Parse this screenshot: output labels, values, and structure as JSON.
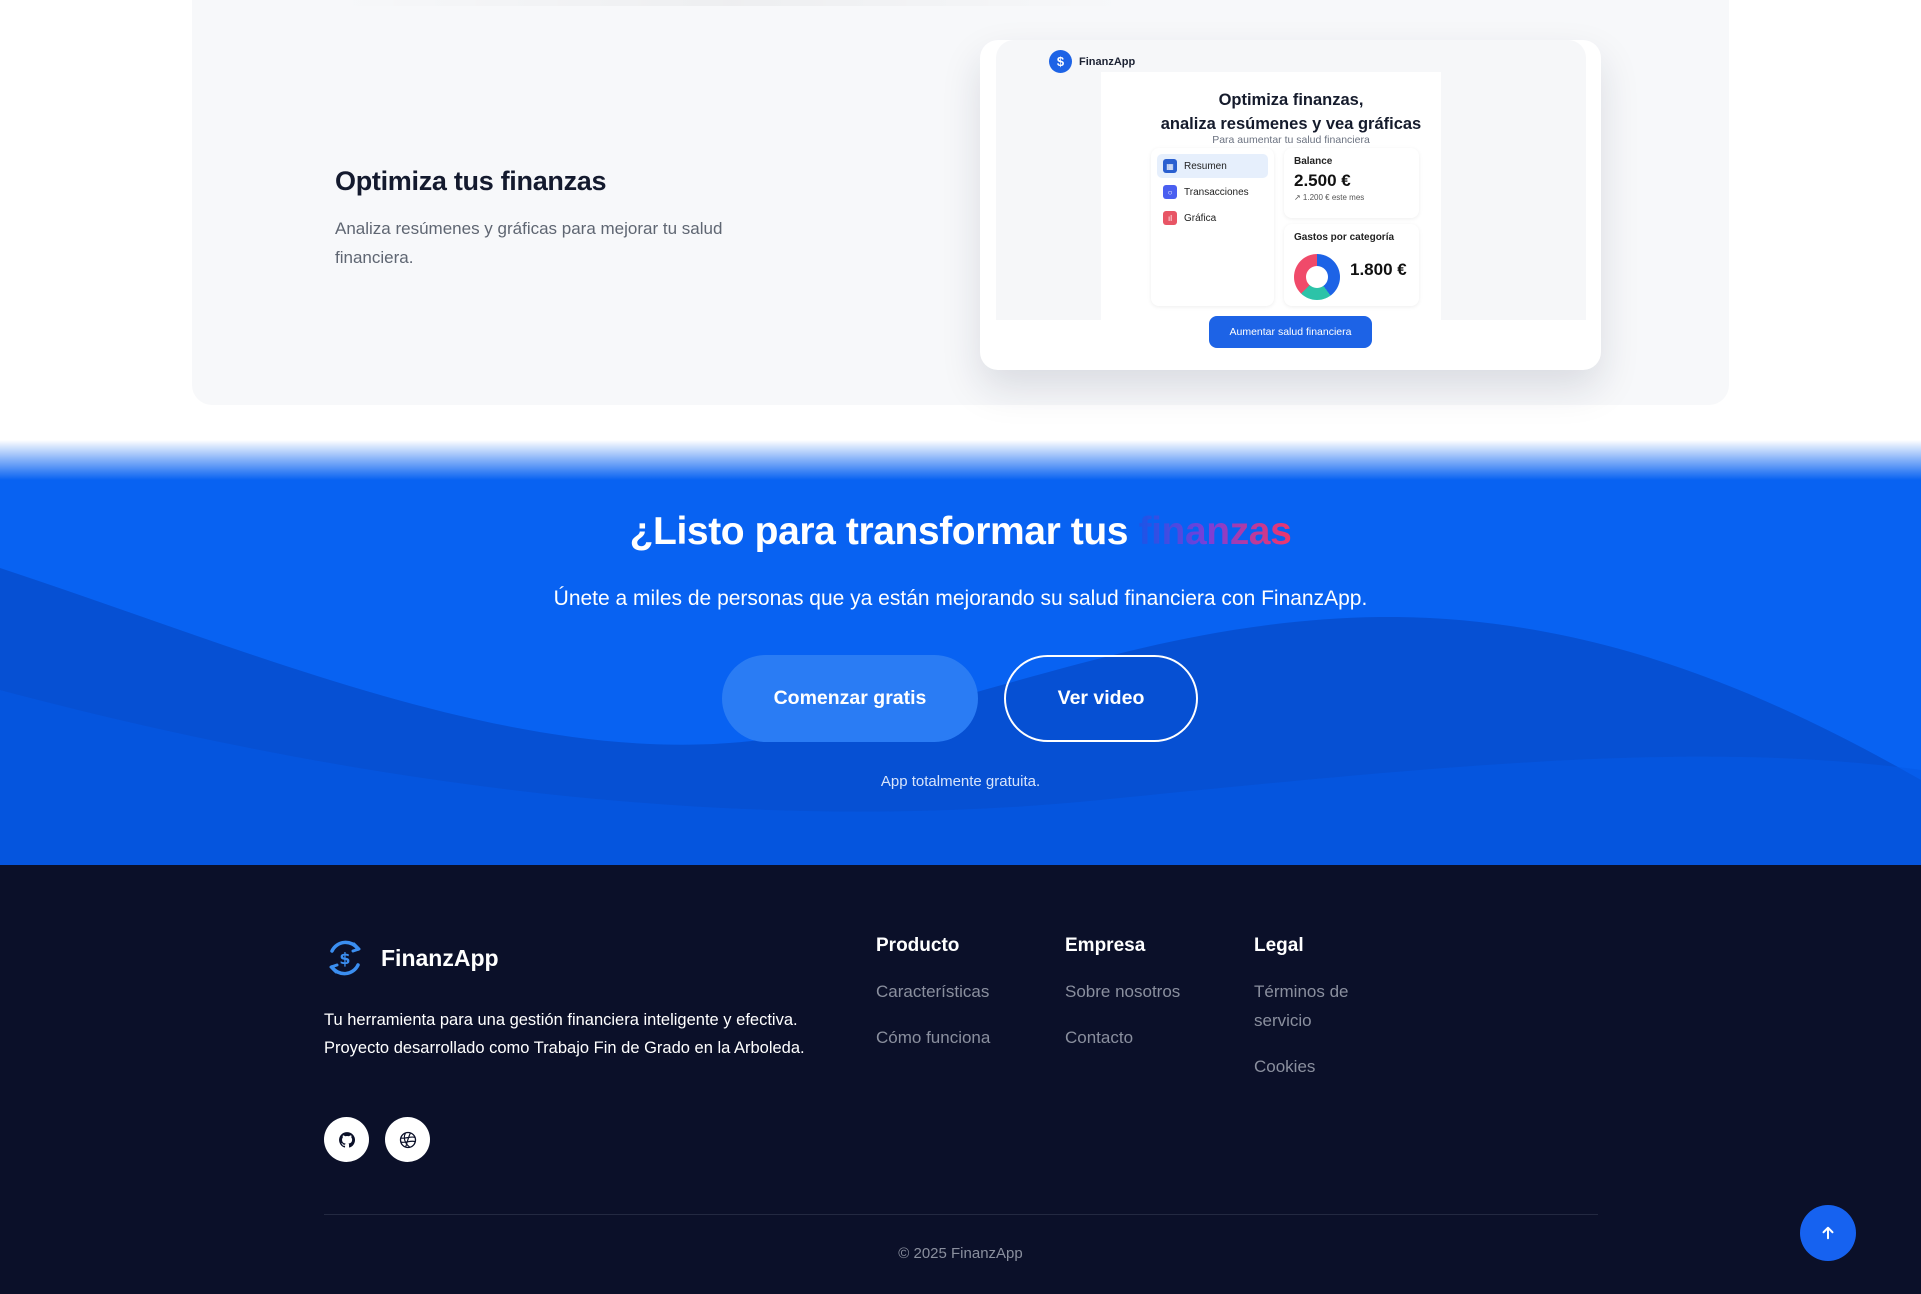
{
  "feature": {
    "title": "Optimiza tus finanzas",
    "description": "Analiza resúmenes y gráficas para mejorar tu salud financiera."
  },
  "mockup": {
    "logo_text": "FinanzApp",
    "logo_symbol": "$",
    "headline_line1": "Optimiza finanzas,",
    "headline_line2": "analiza resúmenes y vea gráficas",
    "subtitle": "Para aumentar tu salud financiera",
    "nav": [
      {
        "label": "Resumen",
        "icon": "summary-icon"
      },
      {
        "label": "Transacciones",
        "icon": "search-icon"
      },
      {
        "label": "Gráfica",
        "icon": "bar-chart-icon"
      }
    ],
    "balance_label": "Balance",
    "balance_value": "2.500 €",
    "balance_note": "↗ 1.200 € este mes",
    "gastos_label": "Gastos por categoría",
    "gastos_value": "1.800 €",
    "button_label": "Aumentar salud financiera"
  },
  "cta": {
    "title_main": "¿Listo para transformar tus",
    "title_highlight": "finanzas",
    "subtitle": "Únete a miles de personas que ya están mejorando su salud financiera con FinanzApp.",
    "primary_button": "Comenzar gratis",
    "secondary_button": "Ver video",
    "note": "App totalmente gratuita."
  },
  "footer": {
    "brand": "FinanzApp",
    "description": "Tu herramienta para una gestión financiera inteligente y efectiva. Proyecto desarrollado como Trabajo Fin de Grado en la Arboleda.",
    "columns": [
      {
        "title": "Producto",
        "links": [
          "Características",
          "Cómo funciona"
        ]
      },
      {
        "title": "Empresa",
        "links": [
          "Sobre nosotros",
          "Contacto"
        ]
      },
      {
        "title": "Legal",
        "links": [
          "Términos de servicio",
          "Cookies"
        ]
      }
    ],
    "copyright": "© 2025 FinanzApp"
  },
  "colors": {
    "brand_blue": "#0862f2",
    "footer_bg": "#0b1029",
    "accent_pink": "#f0366a"
  }
}
